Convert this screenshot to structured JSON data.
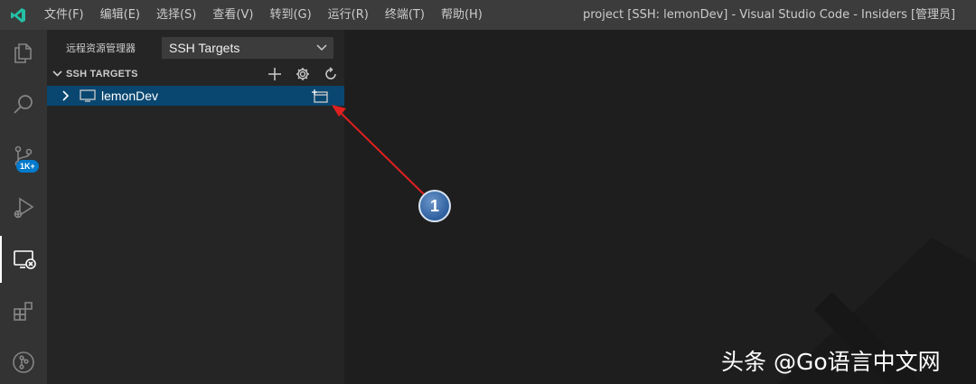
{
  "menu": [
    "文件(F)",
    "编辑(E)",
    "选择(S)",
    "查看(V)",
    "转到(G)",
    "运行(R)",
    "终端(T)",
    "帮助(H)"
  ],
  "window_title": "project [SSH: lemonDev] - Visual Studio Code - Insiders [管理员]",
  "activity_badge": "1K+",
  "sidebar": {
    "title": "远程资源管理器",
    "select_value": "SSH Targets",
    "section_title": "SSH TARGETS",
    "row_label": "lemonDev"
  },
  "callout_number": "1",
  "watermark": "头条 @Go语言中文网",
  "colors": {
    "titlebar": "#3c3c3c",
    "activitybar": "#333333",
    "sidebar": "#252526",
    "selected_row": "#094771",
    "editor": "#1e1e1e",
    "arrow": "#e02020",
    "logo": "#24bfa5"
  }
}
